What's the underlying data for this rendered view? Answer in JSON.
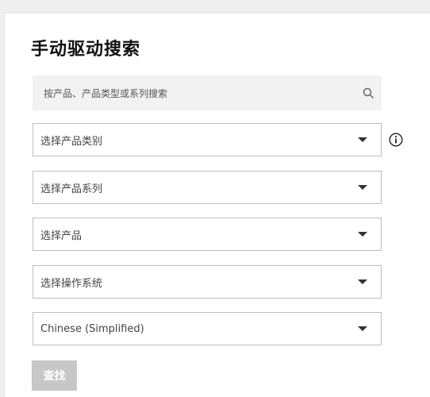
{
  "page": {
    "title": "手动驱动搜索"
  },
  "search": {
    "placeholder": "按产品、产品类型或系列搜索",
    "icon": "search-icon"
  },
  "dropdowns": [
    {
      "label": "选择产品类别"
    },
    {
      "label": "选择产品系列"
    },
    {
      "label": "选择产品"
    },
    {
      "label": "选择操作系统"
    },
    {
      "label": "Chinese (Simplified)"
    }
  ],
  "info": {
    "icon": "info-icon"
  },
  "find_button": {
    "label": "查找"
  },
  "colors": {
    "background": "#efefef",
    "panel": "#ffffff",
    "search_bg": "#f2f2f2",
    "border": "#bdbdbd",
    "button_disabled": "#c7c7c7"
  }
}
